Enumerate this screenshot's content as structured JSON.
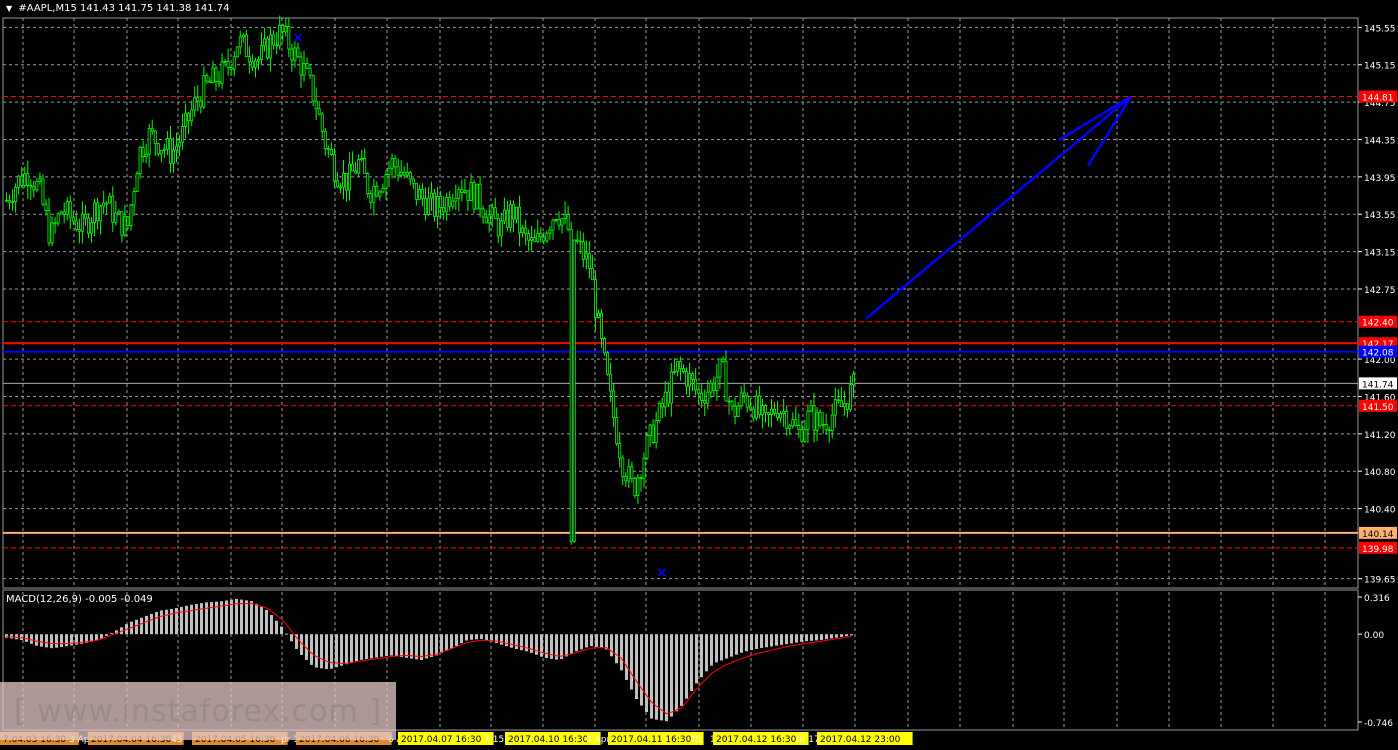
{
  "header": {
    "symbol": "#AAPL,M15",
    "ohlc": "141.43 141.75 141.38 141.74"
  },
  "macd_header": "MACD(12,26,9) -0.005 -0.049",
  "watermark": "[ www.instaforex.com ]",
  "colors": {
    "background": "#000000",
    "grid": "#9a9a9a",
    "candle": "#00ff00",
    "support_red": "#ff0000",
    "support_blue": "#0000ff",
    "support_orange": "#ffb070",
    "arrow_blue": "#0000ff",
    "macd_hist": "#c0c0c0",
    "macd_signal": "#ff0000",
    "time_label_bg": "#ffff00",
    "time_label_alt_bg": "#e08a2a"
  },
  "chart_data": {
    "type": "candlestick",
    "symbol": "#AAPL",
    "timeframe": "M15",
    "ylim": [
      139.55,
      145.65
    ],
    "y_ticks": [
      "145.55",
      "145.15",
      "144.75",
      "144.35",
      "143.95",
      "143.55",
      "143.15",
      "142.75",
      "142.00",
      "141.60",
      "141.20",
      "140.80",
      "140.40",
      "139.65"
    ],
    "price_path": [
      143.7,
      143.9,
      144.0,
      143.8,
      143.3,
      143.6,
      143.5,
      143.4,
      143.6,
      143.7,
      143.5,
      143.4,
      144.2,
      144.4,
      144.3,
      144.2,
      144.4,
      144.7,
      144.9,
      145.0,
      145.1,
      145.4,
      145.3,
      145.2,
      145.4,
      145.5,
      145.3,
      145.1,
      144.8,
      144.3,
      144.0,
      143.9,
      144.1,
      143.8,
      143.9,
      144.1,
      144.0,
      143.8,
      143.7,
      143.6,
      143.7,
      143.9,
      143.8,
      143.7,
      143.5,
      143.4,
      143.6,
      143.3,
      143.2,
      143.4,
      143.6,
      143.4,
      143.2,
      143.0,
      142.2,
      141.5,
      140.9,
      140.6,
      141.0,
      141.3,
      141.6,
      141.9,
      141.8,
      141.6,
      141.7,
      141.9,
      141.4,
      141.6,
      141.5,
      141.3,
      141.5,
      141.4,
      141.2,
      141.4,
      141.3,
      141.4,
      141.5,
      141.7
    ],
    "levels": [
      {
        "label": "144.81",
        "color": "#ff0000",
        "style": "dashed",
        "value": 144.81
      },
      {
        "label": "142.40",
        "color": "#ff0000",
        "style": "dashed",
        "value": 142.4
      },
      {
        "label": "142.17",
        "color": "#ff0000",
        "style": "solid",
        "value": 142.17
      },
      {
        "label": "142.08",
        "color": "#0000ff",
        "style": "solid",
        "value": 142.08
      },
      {
        "label": "141.74",
        "color": "#aaaaaa",
        "style": "solid",
        "value": 141.74
      },
      {
        "label": "141.50",
        "color": "#ff0000",
        "style": "dashed",
        "value": 141.5
      },
      {
        "label": "140.14",
        "color": "#ffb070",
        "style": "solid",
        "value": 140.14
      },
      {
        "label": "139.98",
        "color": "#ff0000",
        "style": "dashed",
        "value": 139.98
      }
    ],
    "markers": [
      {
        "symbol": "x",
        "price": 145.55,
        "position": "top"
      },
      {
        "symbol": "x",
        "price": 139.75,
        "position": "bottom"
      }
    ],
    "forecast_arrow": {
      "from_price": 142.4,
      "to_price": 144.81
    },
    "macd": {
      "label": "MACD(12,26,9)",
      "main": -0.005,
      "signal": -0.049,
      "ylim": [
        -0.746,
        0.316
      ],
      "y_ticks": [
        "0.316",
        "0.00",
        "-0.746"
      ],
      "hist_path": [
        -0.03,
        -0.05,
        -0.1,
        -0.12,
        -0.1,
        -0.08,
        -0.05,
        0.02,
        0.1,
        0.15,
        0.2,
        0.22,
        0.25,
        0.27,
        0.28,
        0.3,
        0.28,
        0.2,
        0.05,
        -0.15,
        -0.28,
        -0.3,
        -0.26,
        -0.22,
        -0.2,
        -0.18,
        -0.2,
        -0.22,
        -0.18,
        -0.12,
        -0.05,
        -0.04,
        -0.08,
        -0.12,
        -0.15,
        -0.2,
        -0.22,
        -0.15,
        -0.1,
        -0.12,
        -0.3,
        -0.55,
        -0.72,
        -0.74,
        -0.6,
        -0.4,
        -0.25,
        -0.2,
        -0.15,
        -0.12,
        -0.1,
        -0.08,
        -0.06,
        -0.05,
        -0.03,
        -0.01
      ],
      "signal_path": [
        -0.02,
        -0.03,
        -0.06,
        -0.08,
        -0.08,
        -0.07,
        -0.05,
        0.0,
        0.05,
        0.1,
        0.15,
        0.18,
        0.2,
        0.22,
        0.24,
        0.26,
        0.26,
        0.22,
        0.12,
        -0.05,
        -0.18,
        -0.24,
        -0.25,
        -0.23,
        -0.21,
        -0.19,
        -0.18,
        -0.19,
        -0.17,
        -0.12,
        -0.07,
        -0.05,
        -0.06,
        -0.09,
        -0.12,
        -0.16,
        -0.19,
        -0.16,
        -0.12,
        -0.11,
        -0.2,
        -0.4,
        -0.58,
        -0.68,
        -0.62,
        -0.45,
        -0.32,
        -0.25,
        -0.2,
        -0.16,
        -0.13,
        -0.1,
        -0.08,
        -0.06,
        -0.04,
        -0.02
      ]
    },
    "x_labels": [
      {
        "text": "7.04.03 16:30",
        "hl": "orange"
      },
      {
        "text": "3 Ap",
        "hl": "none"
      },
      {
        "text": "2017.04.04 16:30",
        "hl": "orange"
      },
      {
        "text": "45",
        "hl": "none"
      },
      {
        "text": "2017.04.05 16:30",
        "hl": "orange"
      },
      {
        "text": "pr 18",
        "hl": "none"
      },
      {
        "text": "2017.04.06 16:30",
        "hl": "orange"
      },
      {
        "text": "6 A",
        "hl": "none"
      },
      {
        "text": "2017.04.07 16:30",
        "hl": "yellow"
      },
      {
        "text": "7:15",
        "hl": "none"
      },
      {
        "text": "2017.04.10 16:30",
        "hl": "yellow"
      },
      {
        "text": "0 Apr",
        "hl": "none"
      },
      {
        "text": "2017.04.11 16:30",
        "hl": "yellow"
      },
      {
        "text": "45",
        "hl": "none"
      },
      {
        "text": "1",
        "hl": "none"
      },
      {
        "text": "2017.04.12 16:30",
        "hl": "yellow"
      },
      {
        "text": "pr 17:",
        "hl": "none"
      },
      {
        "text": "2017.04.12 23:00",
        "hl": "yellow"
      }
    ]
  }
}
